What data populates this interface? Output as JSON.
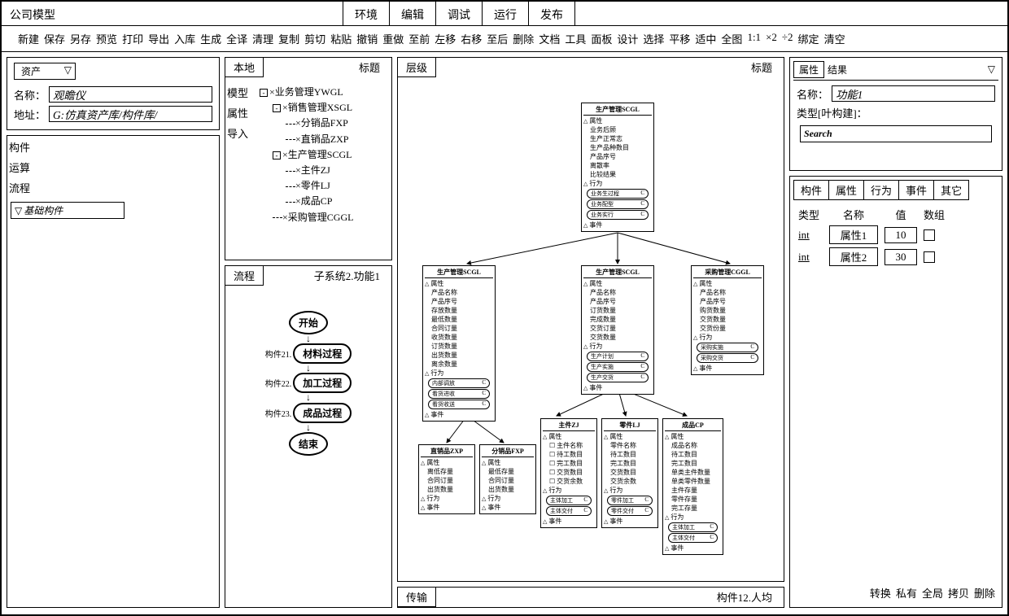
{
  "app_title": "公司模型",
  "top_tabs": [
    "环境",
    "编辑",
    "调试",
    "运行",
    "发布"
  ],
  "toolbar": [
    "新建",
    "保存",
    "另存",
    "预览",
    "打印",
    "导出",
    "入库",
    "生成",
    "全译",
    "清理",
    "复制",
    "剪切",
    "粘贴",
    "撤销",
    "重做",
    "至前",
    "左移",
    "右移",
    "至后",
    "删除",
    "文档",
    "工具",
    "面板",
    "设计",
    "选择",
    "平移",
    "适中",
    "全图",
    "1:1",
    "×2",
    "÷2",
    "绑定",
    "清空"
  ],
  "asset": {
    "title": "资产",
    "name_label": "名称：",
    "name_value": "观瞻仪",
    "addr_label": "地址：",
    "addr_value": "G:仿真资产库/构件库/"
  },
  "component_sidebar": [
    "构件",
    "运算",
    "流程"
  ],
  "component_combo": "基础构件",
  "local": {
    "tab": "本地",
    "title_label": "标题",
    "sidebar": [
      "模型",
      "属性",
      "导入"
    ],
    "tree": [
      {
        "indent": 0,
        "box": "-",
        "label": "×业务管理YWGL"
      },
      {
        "indent": 1,
        "box": "-",
        "label": "×销售管理XSGL"
      },
      {
        "indent": 2,
        "box": "",
        "label": "×分销品FXP"
      },
      {
        "indent": 2,
        "box": "",
        "label": "×直销品ZXP"
      },
      {
        "indent": 1,
        "box": "-",
        "label": "×生产管理SCGL"
      },
      {
        "indent": 2,
        "box": "",
        "label": "×主件ZJ"
      },
      {
        "indent": 2,
        "box": "",
        "label": "×零件LJ"
      },
      {
        "indent": 2,
        "box": "",
        "label": "×成品CP"
      },
      {
        "indent": 1,
        "box": "",
        "label": "×采购管理CGGL"
      }
    ]
  },
  "flow": {
    "tab": "流程",
    "title_label": "子系统2.功能1",
    "start": "开始",
    "end": "结束",
    "steps": [
      {
        "label": "构件21.",
        "name": "材料过程"
      },
      {
        "label": "构件22.",
        "name": "加工过程"
      },
      {
        "label": "构件23.",
        "name": "成品过程"
      }
    ]
  },
  "hierarchy": {
    "tab": "层级",
    "title_label": "标题",
    "transport_tab": "传输",
    "transport_title": "构件12.人均",
    "section_labels": {
      "attrs": "属性",
      "behav": "行为",
      "events": "事件"
    },
    "nodes": {
      "root": {
        "title": "生产管理SCGL",
        "attrs": [
          "业务后顾",
          "生产正常志",
          "生产品种数目",
          "产品序号",
          "离散率",
          "比较结果"
        ],
        "behav": [
          "业务生过程",
          "业务配型",
          "业务实行"
        ]
      },
      "scgl1": {
        "title": "生产管理SCGL",
        "attrs": [
          "产品名称",
          "产品序号",
          "存放数量",
          "最低数量",
          "合同订量",
          "收货数量",
          "订货数量",
          "出货数量",
          "离余数量"
        ],
        "behav": [
          "内部调放",
          "看货进收",
          "看货收送"
        ]
      },
      "scgl2": {
        "title": "生产管理SCGL",
        "attrs": [
          "产品名称",
          "产品序号",
          "订货数量",
          "完成数量",
          "交货订量",
          "交货数量"
        ],
        "behav": [
          "生产计划",
          "生产实施",
          "生产交货"
        ]
      },
      "cggl": {
        "title": "采购管理CGGL",
        "attrs": [
          "产品名称",
          "产品序号",
          "购货数量",
          "交货数量",
          "交货份量"
        ],
        "behav": [
          "采购实施",
          "采购交货"
        ]
      },
      "zxp": {
        "title": "直销品ZXP",
        "attrs": [
          "离低存量",
          "合同订量",
          "出货数量"
        ]
      },
      "fxp": {
        "title": "分销品FXP",
        "attrs": [
          "最低存量",
          "合同订量",
          "出货数量"
        ]
      },
      "zj": {
        "title": "主件ZJ",
        "attrs": [
          "主件名称",
          "待工数目",
          "完工数目",
          "交货数目",
          "交货余数"
        ],
        "behav": [
          "主体加工",
          "主体交付"
        ],
        "checkboxes": true
      },
      "lj": {
        "title": "零件LJ",
        "attrs": [
          "零件名称",
          "待工数目",
          "完工数目",
          "交货数目",
          "交货余数"
        ],
        "behav": [
          "零件加工",
          "零件交付"
        ]
      },
      "cp": {
        "title": "成品CP",
        "attrs": [
          "成品名称",
          "待工数目",
          "完工数目",
          "单类主件数量",
          "单类零件数量",
          "主件存量",
          "零件存量",
          "完工存量"
        ],
        "behav": [
          "主体加工",
          "主体交付"
        ]
      }
    }
  },
  "properties": {
    "tab_attr": "属性",
    "tab_result": "结果",
    "name_label": "名称：",
    "name_value": "功能1",
    "type_label": "类型[叶构建]：",
    "search_placeholder": "Search"
  },
  "attr_panel": {
    "tabs": [
      "构件",
      "属性",
      "行为",
      "事件",
      "其它"
    ],
    "headers": {
      "type": "类型",
      "name": "名称",
      "value": "值",
      "array": "数组"
    },
    "rows": [
      {
        "type": "int",
        "name": "属性1",
        "value": "10"
      },
      {
        "type": "int",
        "name": "属性2",
        "value": "30"
      }
    ],
    "actions": [
      "转换",
      "私有",
      "全局",
      "拷贝",
      "删除"
    ]
  }
}
